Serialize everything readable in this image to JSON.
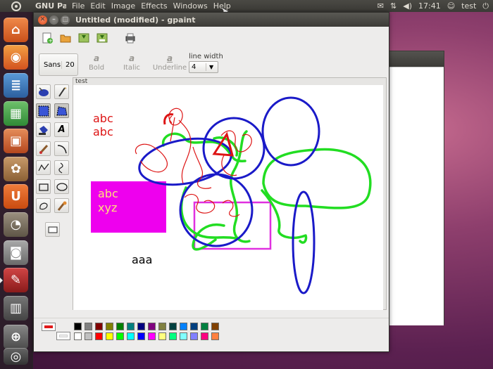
{
  "top_panel": {
    "app_name": "GNU Paint",
    "menus": [
      "File",
      "Edit",
      "Image",
      "Effects",
      "Windows",
      "Help"
    ],
    "clock": "17:41",
    "user": "test"
  },
  "window": {
    "title": "Untitled (modified) - gpaint"
  },
  "toolbar": {
    "font_name": "Sans",
    "font_size": "20",
    "bold_label": "Bold",
    "italic_label": "Italic",
    "underline_label": "Underline",
    "line_width_label": "line width",
    "line_width_value": "4"
  },
  "canvas": {
    "label": "test",
    "texts": {
      "abc1": "abc",
      "abc2": "abc",
      "magenta_abc": "abc",
      "magenta_xyz": "xyz",
      "aaa": "aaa"
    }
  },
  "palette": {
    "fg_color": "#e01a1a",
    "colors_row1": [
      "#000000",
      "#808080",
      "#800000",
      "#808000",
      "#008000",
      "#008080",
      "#000080",
      "#800080",
      "#808040",
      "#004040",
      "#0080ff",
      "#004080",
      "#008040",
      "#804000"
    ],
    "colors_row2": [
      "#ffffff",
      "#c0c0c0",
      "#ff0000",
      "#ffff00",
      "#00ff00",
      "#00ffff",
      "#0000ff",
      "#ff00ff",
      "#ffff80",
      "#00ff80",
      "#80ffff",
      "#8080ff",
      "#ff0080",
      "#ff8040"
    ]
  },
  "icons": {
    "launcher": [
      "home-folder-icon",
      "firefox-icon",
      "writer-icon",
      "calc-icon",
      "impress-icon",
      "software-center-icon",
      "ubuntu-one-icon",
      "gimp-icon",
      "screenshot-icon",
      "gpaint-icon",
      "workspace-icon",
      "zoom-icon",
      "trash-icon"
    ]
  }
}
